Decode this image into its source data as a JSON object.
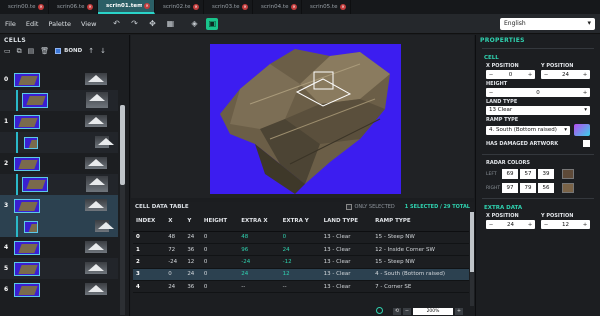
{
  "tabs": [
    {
      "label": "scrin00.tem (TS)",
      "active": false
    },
    {
      "label": "scrin06.tem (TS)",
      "active": false
    },
    {
      "label": "scrin01.tem (TS)",
      "active": true
    },
    {
      "label": "scrin02.tem (TS)",
      "active": false
    },
    {
      "label": "scrin03.tem (TS)",
      "active": false
    },
    {
      "label": "scrin04.tem (TS)",
      "active": false
    },
    {
      "label": "scrin05.tem (TS)",
      "active": false
    }
  ],
  "menu": {
    "file": "File",
    "edit": "Edit",
    "palette": "Palette",
    "view": "View"
  },
  "language": "English",
  "cells_panel": {
    "title": "CELLS",
    "bond_label": "BOND",
    "rows": [
      {
        "num": "0"
      },
      {
        "num": ""
      },
      {
        "num": "1"
      },
      {
        "num": ""
      },
      {
        "num": "2"
      },
      {
        "num": ""
      },
      {
        "num": "3"
      },
      {
        "num": ""
      },
      {
        "num": "4"
      },
      {
        "num": "5"
      },
      {
        "num": "6"
      }
    ]
  },
  "table": {
    "title": "CELL DATA TABLE",
    "only_selected": "ONLY SELECTED",
    "count": "1 SELECTED / 29 TOTAL",
    "headers": [
      "INDEX",
      "X",
      "Y",
      "HEIGHT",
      "EXTRA X",
      "EXTRA Y",
      "LAND TYPE",
      "RAMP TYPE"
    ],
    "rows": [
      {
        "index": "0",
        "x": "48",
        "y": "24",
        "height": "0",
        "extra_x": "48",
        "extra_y": "0",
        "land": "13 - Clear",
        "ramp": "15 - Steep NW"
      },
      {
        "index": "1",
        "x": "72",
        "y": "36",
        "height": "0",
        "extra_x": "96",
        "extra_y": "24",
        "land": "13 - Clear",
        "ramp": "12 - Inside Corner SW"
      },
      {
        "index": "2",
        "x": "-24",
        "y": "12",
        "height": "0",
        "extra_x": "-24",
        "extra_y": "-12",
        "land": "13 - Clear",
        "ramp": "15 - Steep NW"
      },
      {
        "index": "3",
        "x": "0",
        "y": "24",
        "height": "0",
        "extra_x": "24",
        "extra_y": "12",
        "land": "13 - Clear",
        "ramp": "4 - South (Bottom raised)"
      },
      {
        "index": "4",
        "x": "24",
        "y": "36",
        "height": "0",
        "extra_x": "--",
        "extra_y": "--",
        "land": "13 - Clear",
        "ramp": "7 - Corner SE"
      }
    ]
  },
  "zoom": "200%",
  "properties": {
    "title": "PROPERTIES",
    "cell_section": "CELL",
    "x_position_label": "X POSITION",
    "x_position": "0",
    "y_position_label": "Y POSITION",
    "y_position": "24",
    "height_label": "HEIGHT",
    "height": "0",
    "land_type_label": "LAND TYPE",
    "land_type": "13 Clear",
    "ramp_type_label": "RAMP TYPE",
    "ramp_type": "4. South (Bottom raised)",
    "damaged_label": "HAS DAMAGED ARTWORK",
    "radar_label": "RADAR COLORS",
    "left_label": "LEFT",
    "left_r": "69",
    "left_g": "57",
    "left_b": "39",
    "right_label": "RIGHT",
    "right_r": "97",
    "right_g": "79",
    "right_b": "56",
    "extra_section": "EXTRA DATA",
    "extra_x": "24",
    "extra_y": "12"
  }
}
